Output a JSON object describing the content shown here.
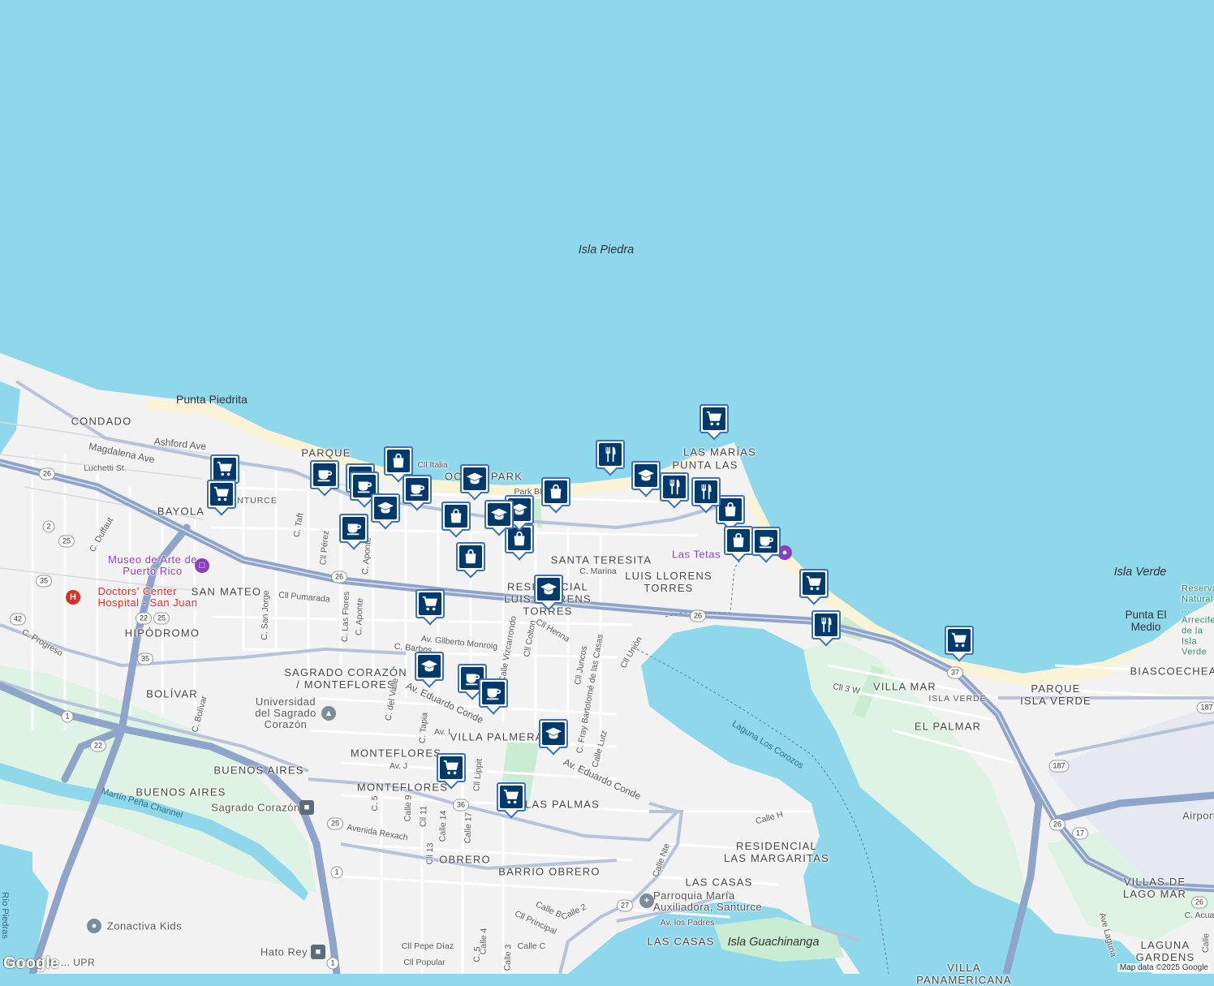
{
  "map": {
    "colors": {
      "water": "#8fd8ec",
      "land": "#f2f2f2",
      "highway": "#8ea4c8",
      "park": "#c9ecd2",
      "pin_border": "#3a72b8",
      "pin_fill": "#003a6c",
      "poi_purple": "#8a3fbf",
      "hospital_red": "#d93025"
    },
    "water_labels": [
      "Isla Piedra",
      "Laguna Los Corozos",
      "Isla Guachinanga",
      "Martín Peña Channel",
      "Río Piedras"
    ],
    "area_labels": [
      "CONDADO",
      "PARQUE",
      "OCEAN PARK",
      "LAS MARÍAS",
      "PUNTA LAS",
      "BAYOLA",
      "SANTA TERESITA",
      "LUIS LLORENS TORRES",
      "RESIDENCIAL LUIS LLORENS TORRES",
      "SAN MATEO",
      "HIPÓDROMO",
      "SAGRADO CORAZÓN / MONTEFLORES",
      "BOLÍVAR",
      "BUENOS AIRES",
      "BUENOS AIRES",
      "MONTEFLORES",
      "MONTEFLORES",
      "VILLA PALMERAS",
      "LAS PALMAS",
      "OBRERO",
      "BARRIO OBRERO",
      "RESIDENCIAL LAS MARGARITAS",
      "LAS CASAS",
      "LAS CASAS",
      "VILLA MAR",
      "EL PALMAR",
      "PARQUE ISLA VERDE",
      "BIASCOECHEA",
      "VILLAS DE LAGO MAR",
      "LAGUNA GARDENS",
      "VILLA PANAMERICANA",
      "ISLA VERDE",
      "Isla Verde",
      "Punta El Medio",
      "Punta Piedrita",
      "SANTURCE"
    ],
    "street_labels": [
      "Ashford Ave",
      "Magdalena Ave",
      "Luchetti St",
      "C. Duffaut",
      "C. Taft",
      "Cll Pérez",
      "C. Aponte",
      "Cll Pumarada",
      "C. San Jorge",
      "C. Las Flores",
      "C. Aponte",
      "Av. Gilberto Monroig",
      "C. Barbos",
      "C. del Valle",
      "C. Tapia",
      "Av. Eduardo Conde",
      "Cll Italia",
      "Park Blvd",
      "C. Marina",
      "Cll Henna",
      "Cll Colton",
      "Calle Vizcarrondo",
      "Cll Juncos",
      "C. Fray Bartolomé de las Casas",
      "Cll Unión",
      "Calle Lutz",
      "Av. Eduardo Conde",
      "Av. I",
      "Av. J",
      "C. 5",
      "Calle 9",
      "Cll 11",
      "Cll 13",
      "Calle 14",
      "Calle 17",
      "Cll Lippit",
      "Avenida Rexach",
      "Calle Nte",
      "Calle H",
      "Calle B",
      "Cll Principal",
      "Calle 2",
      "Av. los Padres",
      "Cll Pepe Díaz",
      "Cll Popular",
      "Calle 4",
      "C. 5",
      "Calle 3",
      "Calle C",
      "Cll 3 W",
      "C. Progreso",
      "C. Bolívar",
      "Ave Laguna",
      "C. Acua",
      "Calle"
    ],
    "poi_labels": [
      "Museo de Arte de Puerto Rico",
      "Doctors' Center Hospital - San Juan",
      "Universidad del Sagrado Corazón",
      "Sagrado Corazón",
      "Parroquia María Auxiliadora, Santurce",
      "Zonactiva Kids",
      "Hato Rey",
      "Las Tetas",
      "Facultad de ... UPR",
      "Airport",
      "Reserva Natural ... Arrecifes de la Isla Verde"
    ],
    "route_shields": [
      "26",
      "2",
      "25",
      "35",
      "42",
      "22",
      "25",
      "35",
      "1",
      "22",
      "26",
      "36",
      "25",
      "1",
      "27",
      "1",
      "37",
      "187",
      "26",
      "17",
      "26",
      "187"
    ],
    "pins": [
      {
        "type": "shopping-cart"
      },
      {
        "type": "shopping-cart"
      },
      {
        "type": "shopping-cart"
      },
      {
        "type": "shopping-cart"
      },
      {
        "type": "shopping-cart"
      },
      {
        "type": "shopping-cart"
      },
      {
        "type": "shopping-cart"
      },
      {
        "type": "shopping-cart"
      },
      {
        "type": "coffee-cup"
      },
      {
        "type": "coffee-cup"
      },
      {
        "type": "coffee-cup"
      },
      {
        "type": "coffee-cup"
      },
      {
        "type": "coffee-cup"
      },
      {
        "type": "coffee-cup"
      },
      {
        "type": "coffee-cup"
      },
      {
        "type": "coffee-cup"
      },
      {
        "type": "shopping-bag"
      },
      {
        "type": "shopping-bag"
      },
      {
        "type": "shopping-bag"
      },
      {
        "type": "shopping-bag"
      },
      {
        "type": "shopping-bag"
      },
      {
        "type": "shopping-bag"
      },
      {
        "type": "shopping-bag"
      },
      {
        "type": "graduation-cap"
      },
      {
        "type": "graduation-cap"
      },
      {
        "type": "graduation-cap"
      },
      {
        "type": "graduation-cap"
      },
      {
        "type": "graduation-cap"
      },
      {
        "type": "graduation-cap"
      },
      {
        "type": "graduation-cap"
      },
      {
        "type": "graduation-cap"
      },
      {
        "type": "fork-knife"
      },
      {
        "type": "fork-knife"
      },
      {
        "type": "fork-knife"
      },
      {
        "type": "fork-knife"
      }
    ],
    "logo": "Google",
    "attribution": "Map data ©2025 Google"
  }
}
